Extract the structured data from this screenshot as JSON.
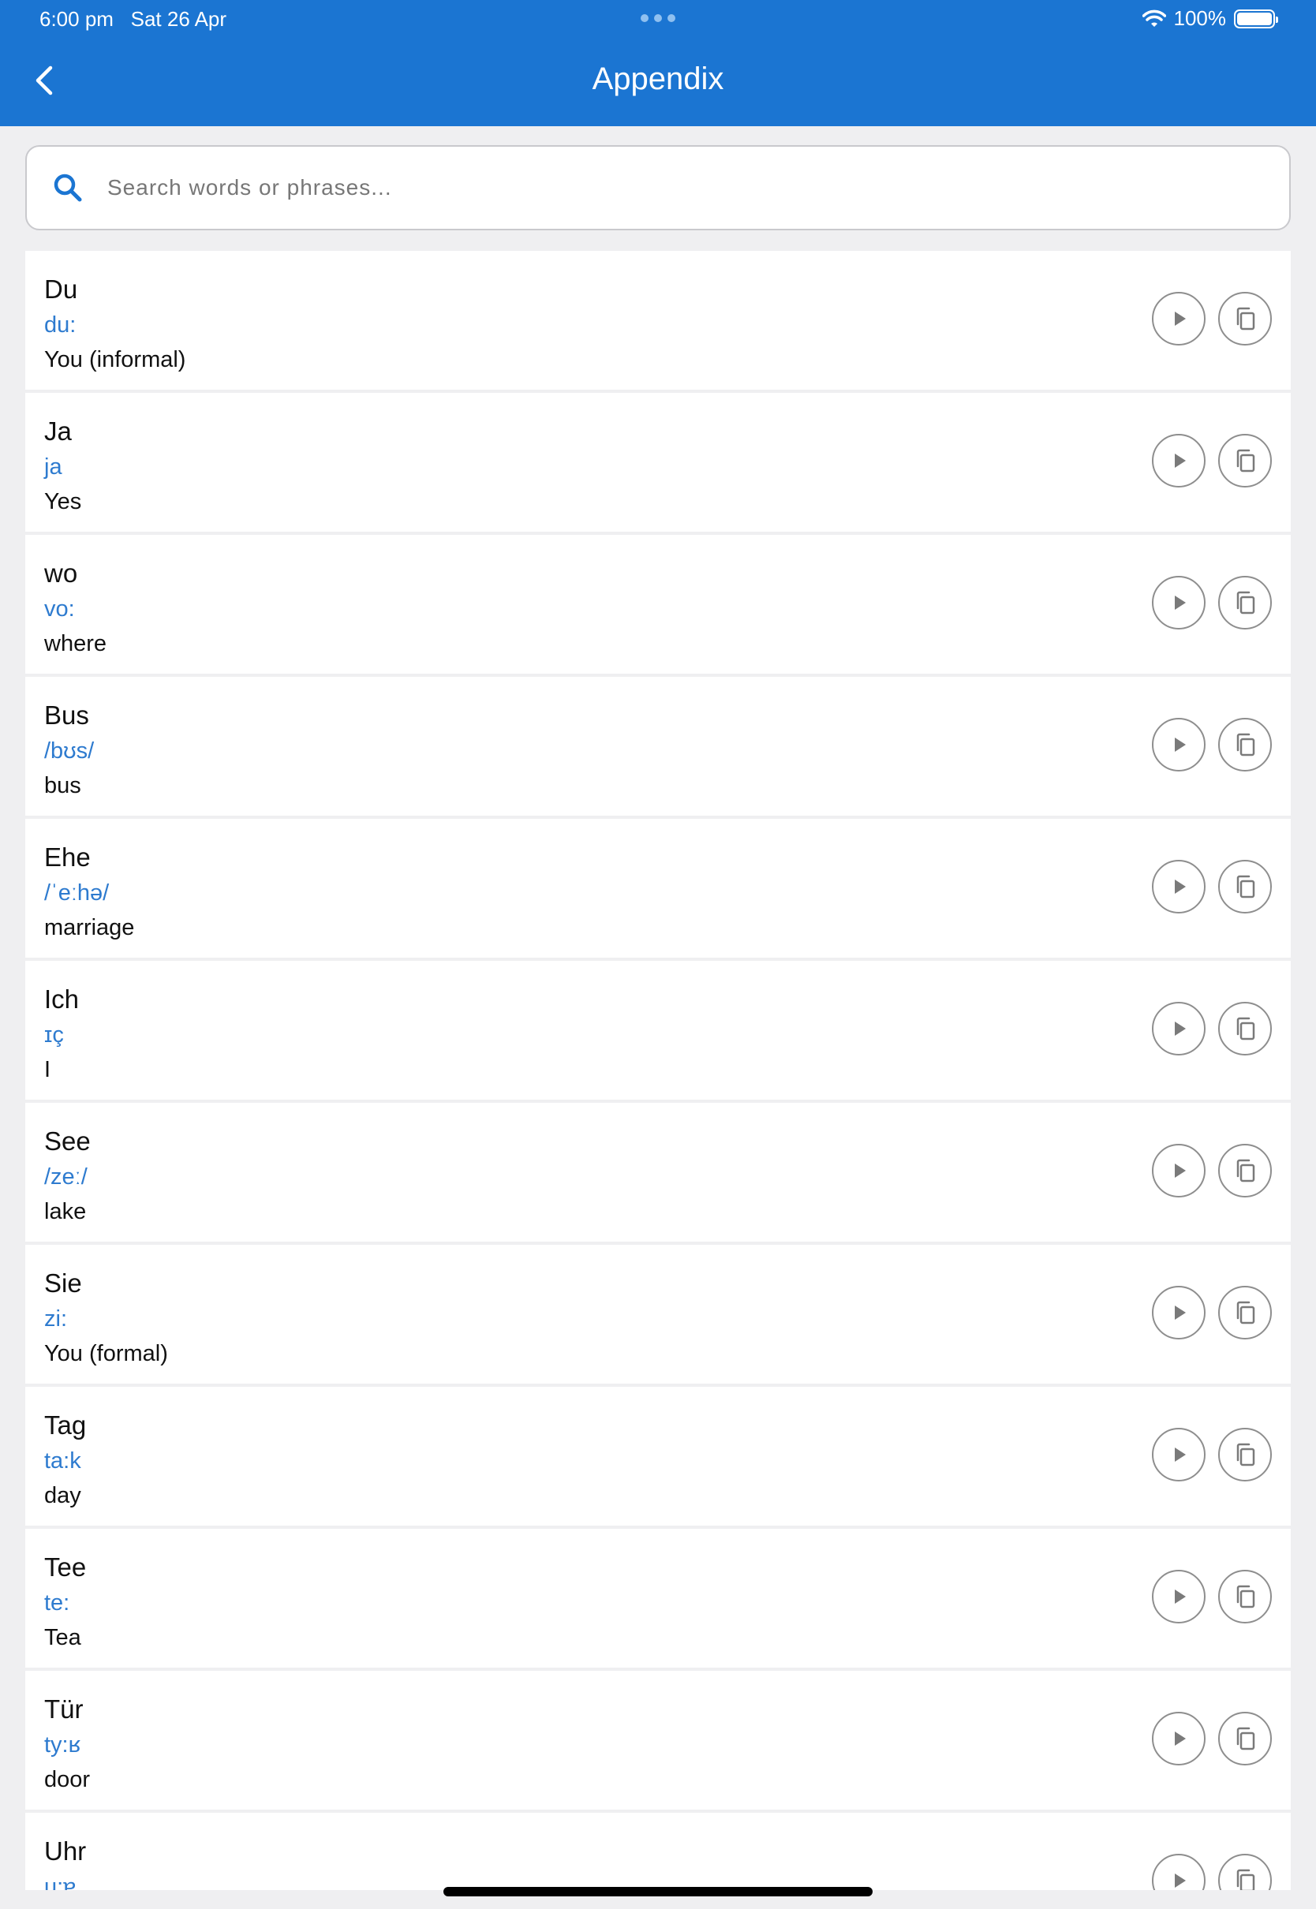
{
  "status_bar": {
    "time": "6:00 pm",
    "date": "Sat 26 Apr",
    "battery": "100%",
    "battery_level": 1.0
  },
  "header": {
    "title": "Appendix",
    "color": "#1B75D2"
  },
  "search": {
    "placeholder": "Search words or phrases..."
  },
  "entries": [
    {
      "word": "Du",
      "ipa": "du:",
      "meaning": "You (informal)"
    },
    {
      "word": "Ja",
      "ipa": "ja",
      "meaning": "Yes"
    },
    {
      "word": "wo",
      "ipa": "vo:",
      "meaning": "where"
    },
    {
      "word": "Bus",
      "ipa": "/bʊs/",
      "meaning": "bus"
    },
    {
      "word": "Ehe",
      "ipa": "/ˈeːhə/",
      "meaning": "marriage"
    },
    {
      "word": "Ich",
      "ipa": "ɪç",
      "meaning": "I"
    },
    {
      "word": "See",
      "ipa": "/zeː/",
      "meaning": "lake"
    },
    {
      "word": "Sie",
      "ipa": "zi:",
      "meaning": "You (formal)"
    },
    {
      "word": "Tag",
      "ipa": "ta:k",
      "meaning": "day"
    },
    {
      "word": "Tee",
      "ipa": "te:",
      "meaning": "Tea"
    },
    {
      "word": "Tür",
      "ipa": "ty:ʁ",
      "meaning": "door"
    },
    {
      "word": "Uhr",
      "ipa": "u:ɐ",
      "meaning": ""
    }
  ],
  "icons": {
    "back": "chevron-left-icon",
    "search": "search-icon",
    "play": "play-icon",
    "copy": "copy-icon",
    "wifi": "wifi-icon",
    "battery": "battery-icon"
  }
}
